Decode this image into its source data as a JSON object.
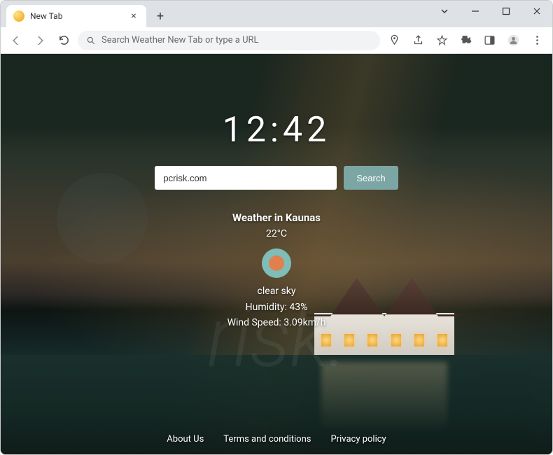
{
  "titlebar": {
    "tab_title": "New Tab"
  },
  "toolbar": {
    "address_placeholder": "Search Weather New Tab or type a URL"
  },
  "page": {
    "clock": "12:42",
    "search_value": "pcrisk.com",
    "search_button": "Search",
    "weather": {
      "title": "Weather in Kaunas",
      "temp": "22°C",
      "condition": "clear sky",
      "humidity": "Humidity: 43%",
      "wind": "Wind Speed: 3.09km/h"
    },
    "footer": {
      "about": "About Us",
      "terms": "Terms and conditions",
      "privacy": "Privacy policy"
    }
  }
}
